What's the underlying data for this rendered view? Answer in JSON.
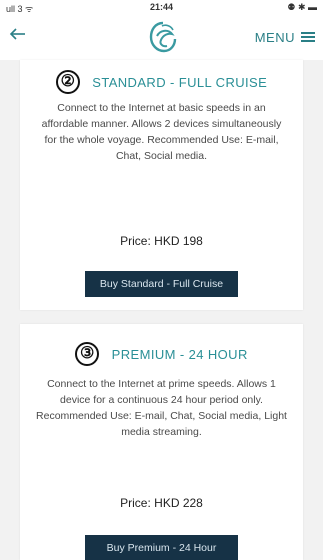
{
  "status_bar": {
    "left": "ull 3 ᯤ",
    "time": "21:44",
    "right": "⚉ ✱ ▬"
  },
  "nav": {
    "back_icon": "arrow-left-icon",
    "menu_label": "MENU",
    "menu_icon": "hamburger-icon",
    "logo_icon": "cruise-logo-icon"
  },
  "plans": [
    {
      "number": "②",
      "title": "STANDARD - FULL CRUISE",
      "description": "Connect to the Internet at basic speeds in an affordable manner. Allows 2 devices simultaneously for the whole voyage. Recommended Use: E-mail, Chat, Social media.",
      "price": "Price: HKD 198",
      "button_label": "Buy Standard - Full Cruise"
    },
    {
      "number": "③",
      "title": "PREMIUM - 24 HOUR",
      "description": "Connect to the Internet at prime speeds. Allows 1 device for a continuous 24 hour period only. Recommended Use: E-mail, Chat, Social media, Light media streaming.",
      "price": "Price: HKD 228",
      "button_label": "Buy Premium - 24 Hour"
    }
  ],
  "colors": {
    "accent": "#2a8f96",
    "button_bg": "#163246",
    "background": "#f2f2f2"
  }
}
